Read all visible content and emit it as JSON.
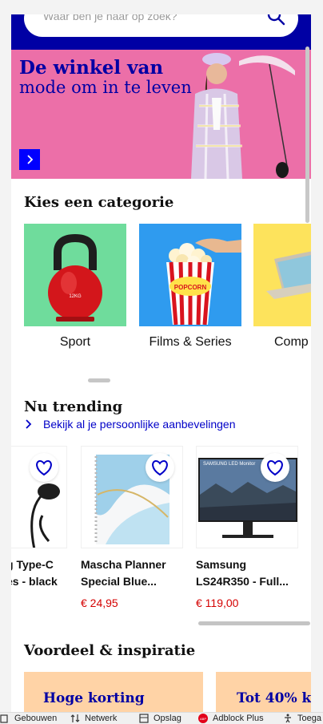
{
  "search": {
    "placeholder": "Waar ben je naar op zoek?"
  },
  "hero": {
    "title": "De winkel van",
    "subtitle": "mode om in te leven"
  },
  "categories": {
    "title": "Kies een categorie",
    "items": [
      {
        "label": "Sport",
        "bg": "#6fdc9c"
      },
      {
        "label": "Films & Series",
        "bg": "#2f9bef"
      },
      {
        "label": "Comp",
        "bg": "#fde35c"
      }
    ],
    "kettlebell_label": "12KG",
    "popcorn_label": "POPCORN"
  },
  "trending": {
    "title": "Nu trending",
    "link": "Bekijk al je persoonlijke aanbevelingen",
    "products": [
      {
        "line1": "g Type-C",
        "line2": "es - black",
        "price": ""
      },
      {
        "line1": "Mascha Planner",
        "line2": "Special Blue...",
        "price": "€ 24,95"
      },
      {
        "line1": "Samsung",
        "line2": "LS24R350 - Full...",
        "price": "€ 119,00",
        "monitor_label": "SAMSUNG LED Monitor"
      }
    ]
  },
  "inspiration": {
    "title": "Voordeel & inspiratie",
    "promos": [
      {
        "text": "Hoge korting"
      },
      {
        "text": "Tot 40% ko"
      }
    ]
  },
  "statusbar": {
    "items": [
      "Gebouwen",
      "Netwerk",
      "Opslag",
      "Adblock Plus",
      "Toega"
    ],
    "abp_badge": "ABP"
  },
  "colors": {
    "brand_blue": "#0000a4",
    "hero_pink": "#ec6fa8",
    "price_red": "#d40000",
    "promo_peach": "#ffd3a6"
  }
}
